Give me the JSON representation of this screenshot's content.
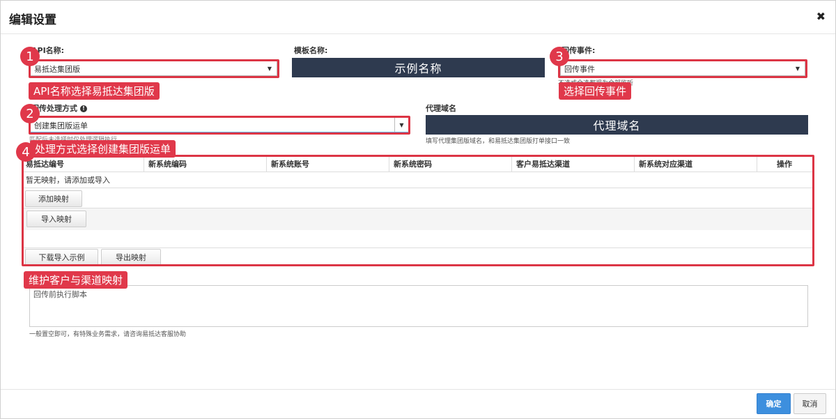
{
  "dialog": {
    "title": "编辑设置",
    "close_glyph": "✖"
  },
  "fields": {
    "api_name": {
      "label": "API名称:",
      "value": "易抵达集团版"
    },
    "template_name": {
      "label": "模板名称:",
      "value": "示例名称"
    },
    "callback_event": {
      "label": "回传事件:",
      "value": "回传事件",
      "hint": "不选或全选都视为全部监听"
    },
    "callback_method": {
      "label": "回传处理方式",
      "value": "创建集团版运单",
      "hint": "匹配后未选择时仅处理逻辑执行"
    },
    "proxy_domain": {
      "label": "代理域名",
      "value": "代理域名",
      "hint": "填写代理集团版域名，和易抵达集团版打单接口一致"
    }
  },
  "mapping_table": {
    "columns": [
      "易抵达编号",
      "新系统编码",
      "新系统账号",
      "新系统密码",
      "客户易抵达渠道",
      "新系统对应渠道",
      "操作"
    ],
    "empty_text": "暂无映射，请添加或导入",
    "add_button": "添加映射",
    "import_button": "导入映射",
    "download_sample_button": "下载导入示例",
    "export_button": "导出映射"
  },
  "script": {
    "placeholder": "回传前执行脚本",
    "hint": "一般置空即可，有特殊业务需求，请咨询易抵达客服协助"
  },
  "annotations": [
    {
      "num": "1",
      "text": "API名称选择易抵达集团版"
    },
    {
      "num": "2",
      "text": "处理方式选择创建集团版运单"
    },
    {
      "num": "3",
      "text": "选择回传事件"
    },
    {
      "num": "4",
      "text": "维护客户与渠道映射"
    }
  ],
  "footer": {
    "confirm": "确定",
    "cancel": "取消"
  },
  "colors": {
    "accent": "#3d8fde",
    "annotation": "#e0384a",
    "dark_box": "#2e3a4f"
  }
}
